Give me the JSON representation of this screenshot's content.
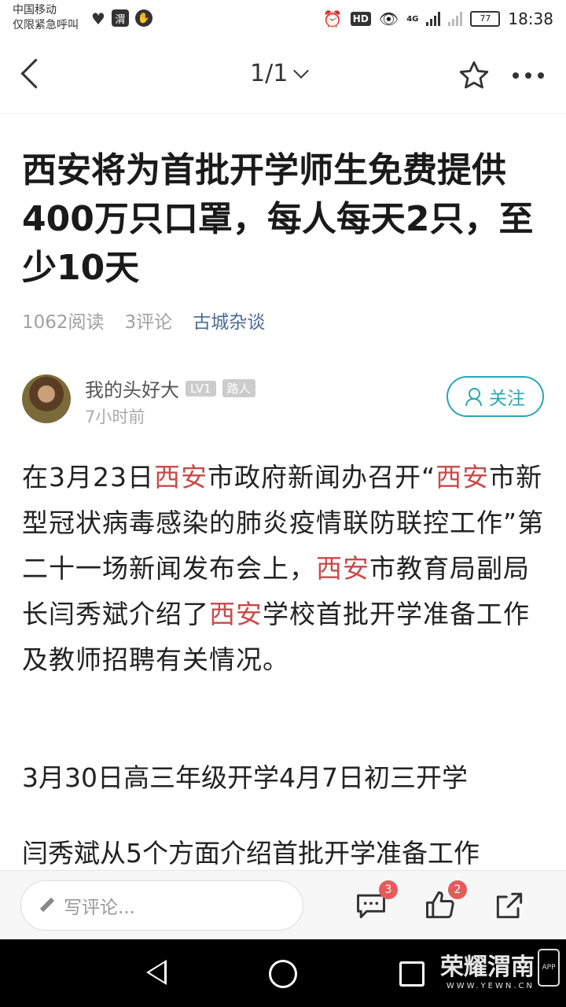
{
  "status_bar": {
    "carrier": "中国移动",
    "carrier_sub": "仅限紧急呼叫",
    "app_icon_text": "渭",
    "hd": "HD",
    "network": "4G",
    "battery": "77",
    "time": "18:38"
  },
  "nav": {
    "pager": "1/1"
  },
  "article": {
    "title": "西安将为首批开学师生免费提供400万只口罩，每人每天2只，至少10天",
    "reads": "1062阅读",
    "comments": "3评论",
    "source": "古城杂谈",
    "author": {
      "name": "我的头好大",
      "level": "LV1",
      "rank": "路人",
      "time": "7小时前",
      "follow_label": "关注"
    },
    "para1": {
      "s1": "在3月23日",
      "h1": "西安",
      "s2": "市政府新闻办召开“",
      "h2": "西安",
      "s3": "市新型冠状病毒感染的肺炎疫情联防联控工作”第二十一场新闻发布会上，",
      "h3": "西安",
      "s4": "市教育局副局长闫秀斌介绍了",
      "h4": "西安",
      "s5": "学校首批开学准备工作及教师招聘有关情况。"
    },
    "para2": "3月30日高三年级开学4月7日初三开学",
    "para3": "闫秀斌从5个方面介绍首批开学准备工作"
  },
  "bottom_bar": {
    "comment_placeholder": "写评论...",
    "comment_count": "3",
    "like_count": "2"
  },
  "watermark": {
    "text": "荣耀渭南",
    "url": "WWW.YEWN.CN",
    "app": "APP"
  },
  "colors": {
    "highlight": "#c94a4a",
    "source_link": "#4a6a95",
    "follow_accent": "#28a8b5",
    "badge": "#e85a5a"
  }
}
